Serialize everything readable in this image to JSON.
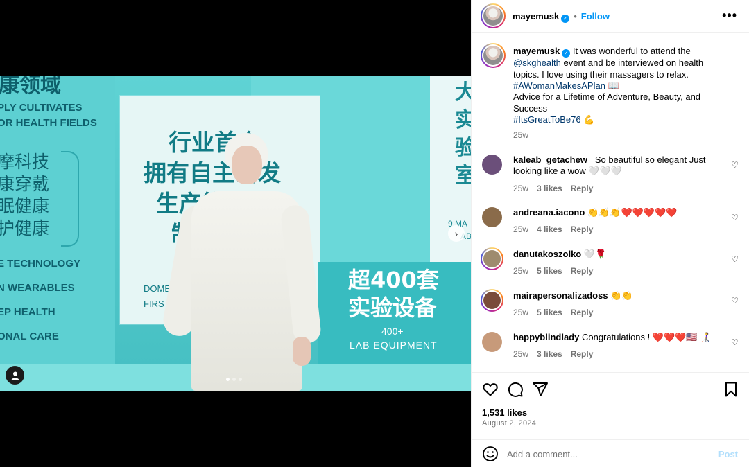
{
  "header": {
    "username": "mayemusk",
    "separator": "•",
    "follow_label": "Follow",
    "more_label": "•••"
  },
  "media": {
    "left_panel": {
      "cn_top": "健康领域",
      "en_lines": [
        "PLY CULTIVATES",
        "OR HEALTH FIELDS"
      ],
      "cn_list": [
        "摩科技",
        "康穿戴",
        "眠健康",
        "护健康"
      ],
      "en_list": [
        "E TECHNOLOGY",
        "N WEARABLES",
        "EP HEALTH",
        "ONAL CARE"
      ]
    },
    "center_board": {
      "cn_lines": [
        "行业首个",
        "拥有自主研发",
        "生产能力的",
        "制造"
      ],
      "en_lines": [
        "DOMES",
        "FIRST IN",
        "U"
      ]
    },
    "right_board": {
      "cn_vertical": "大实验室",
      "en_line1": "9 MA",
      "en_line2": "AB"
    },
    "equip_panel": {
      "cn_line1": "超400套",
      "cn_line2": "实验设备",
      "count": "400+",
      "en": "LAB EQUIPMENT"
    },
    "next_label": "›",
    "slide_count": 3,
    "active_slide": 1
  },
  "caption": {
    "username": "mayemusk",
    "text_intro": "It was wonderful to attend the",
    "mention": "@skghealth",
    "text_after_mention": "event and be interviewed on health topics. I love using their massagers to relax.",
    "hashtag1": "#AWomanMakesAPlan",
    "hashtag1_emoji": "📖",
    "text_after_tag": "Advice for a Lifetime of Adventure, Beauty, and Success",
    "hashtag2": "#ItsGreatToBe76",
    "hashtag2_emoji": "💪",
    "time": "25w"
  },
  "comments": [
    {
      "user": "kaleab_getachew_",
      "text": "So beautiful so elegant Just looking like a wow 🤍🤍🤍",
      "time": "25w",
      "likes": "3 likes",
      "reply": "Reply",
      "avatar_color": "#6b4f7a"
    },
    {
      "user": "andreana.iacono",
      "text": "👏👏👏❤️❤️❤️❤️❤️",
      "time": "25w",
      "likes": "4 likes",
      "reply": "Reply",
      "avatar_color": "#8a6b4a"
    },
    {
      "user": "danutakoszolko",
      "text": "🤍🌹",
      "time": "25w",
      "likes": "5 likes",
      "reply": "Reply",
      "avatar_color": "#9e8b6e"
    },
    {
      "user": "mairapersonalizadoss",
      "text": "👏👏",
      "time": "25w",
      "likes": "5 likes",
      "reply": "Reply",
      "avatar_color": "#7a4b3a"
    },
    {
      "user": "happyblindlady",
      "text": "Congratulations ! ❤️❤️❤️🇺🇸 👩‍🦯",
      "time": "25w",
      "likes": "3 likes",
      "reply": "Reply",
      "avatar_color": "#c79a7a"
    }
  ],
  "actions": {
    "likes": "1,531 likes",
    "date": "August 2, 2024"
  },
  "add_comment": {
    "placeholder": "Add a comment...",
    "post_label": "Post"
  },
  "colors": {
    "link": "#00376b",
    "follow": "#0095f6",
    "post_disabled": "#b2dffc",
    "photo_bg": "#52c8cb"
  }
}
